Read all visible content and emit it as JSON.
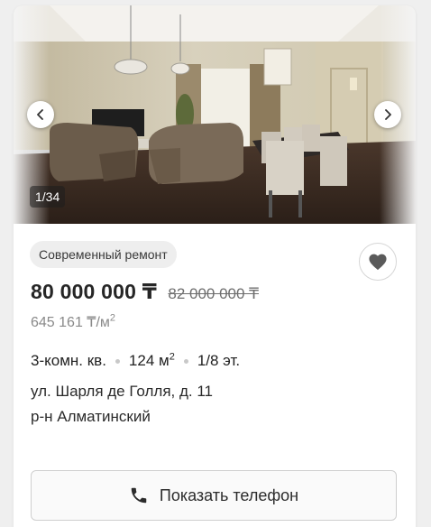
{
  "gallery": {
    "counter": "1/34",
    "prev_icon": "chevron-left-icon",
    "next_icon": "chevron-right-icon"
  },
  "listing": {
    "badge": "Современный ремонт",
    "price": "80 000 000 ₸",
    "old_price": "82 000 000 ₸",
    "price_per_m_value": "645 161 ₸/м",
    "price_per_m_sup": "2",
    "rooms": "3-комн. кв.",
    "area_value": "124 м",
    "area_sup": "2",
    "floor": "1/8 эт.",
    "address": "ул. Шарля де Голля, д. 11",
    "district": "р-н Алматинский"
  },
  "actions": {
    "favorite_icon": "heart-icon",
    "phone_icon": "phone-icon",
    "phone_label": "Показать телефон"
  },
  "colors": {
    "text": "#262626",
    "muted": "#8a8a8a",
    "badge_bg": "#eeeeee",
    "heart": "#5a5a5a"
  }
}
